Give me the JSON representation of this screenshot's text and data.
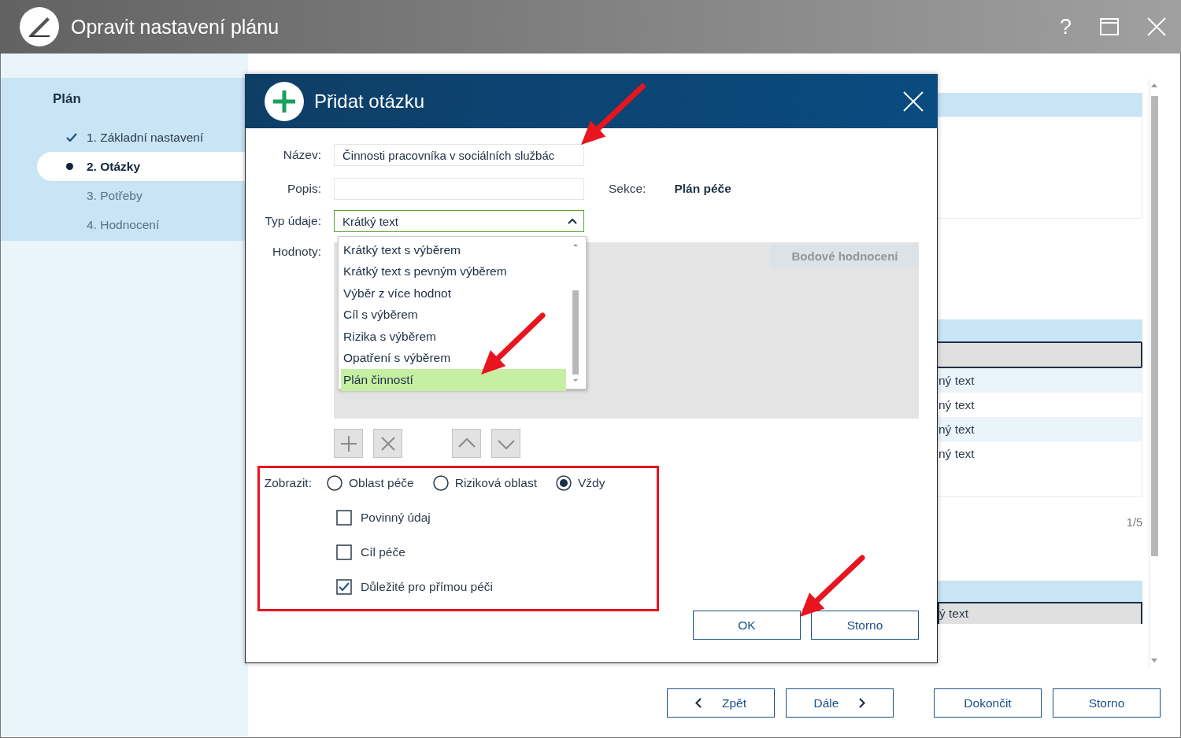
{
  "window": {
    "title": "Opravit nastavení plánu",
    "help": "?"
  },
  "sidebar": {
    "heading": "Plán",
    "steps": [
      {
        "label": "1. Základní nastavení",
        "done": true,
        "selected": false
      },
      {
        "label": "2. Otázky",
        "done": false,
        "selected": true
      },
      {
        "label": "3. Potřeby",
        "done": false,
        "selected": false
      },
      {
        "label": "4. Hodnocení",
        "done": false,
        "selected": false
      }
    ]
  },
  "background": {
    "rows": [
      "ný text",
      "ný text",
      "ný text",
      "ný text"
    ],
    "pager": "1/5",
    "bottom_cell": "ý text"
  },
  "dialog": {
    "title": "Přidat otázku",
    "name": {
      "label": "Název:",
      "value": "Činnosti pracovníka v sociálních službác"
    },
    "description": {
      "label": "Popis:"
    },
    "section": {
      "label": "Sekce:",
      "value": "Plán péče"
    },
    "type": {
      "label": "Typ údaje:",
      "value": "Krátký text",
      "expanded": true,
      "options": [
        {
          "label": "Krátký text s výběrem",
          "selected": false
        },
        {
          "label": "Krátký text s pevným výběrem",
          "selected": false
        },
        {
          "label": "Výběr z více hodnot",
          "selected": false
        },
        {
          "label": "Cíl s výběrem",
          "selected": false
        },
        {
          "label": "Rizika s výběrem",
          "selected": false
        },
        {
          "label": "Opatření s výběrem",
          "selected": false
        },
        {
          "label": "Plán činností",
          "selected": true
        }
      ]
    },
    "values": {
      "label": "Hodnoty:",
      "column": "Bodové hodnocení"
    },
    "display": {
      "label": "Zobrazit:",
      "options": [
        {
          "label": "Oblast péče",
          "selected": false
        },
        {
          "label": "Riziková oblast",
          "selected": false
        },
        {
          "label": "Vždy",
          "selected": true
        }
      ]
    },
    "checks": [
      {
        "label": "Povinný údaj",
        "checked": false
      },
      {
        "label": "Cíl péče",
        "checked": false
      },
      {
        "label": "Důležité pro přímou péči",
        "checked": true
      }
    ],
    "buttons": [
      "OK",
      "Storno"
    ]
  },
  "footer_buttons": [
    {
      "label": "Zpět",
      "kind": "back"
    },
    {
      "label": "Dále",
      "kind": "next"
    },
    {
      "label": "Dokončit",
      "kind": "plain"
    },
    {
      "label": "Storno",
      "kind": "plain"
    }
  ]
}
